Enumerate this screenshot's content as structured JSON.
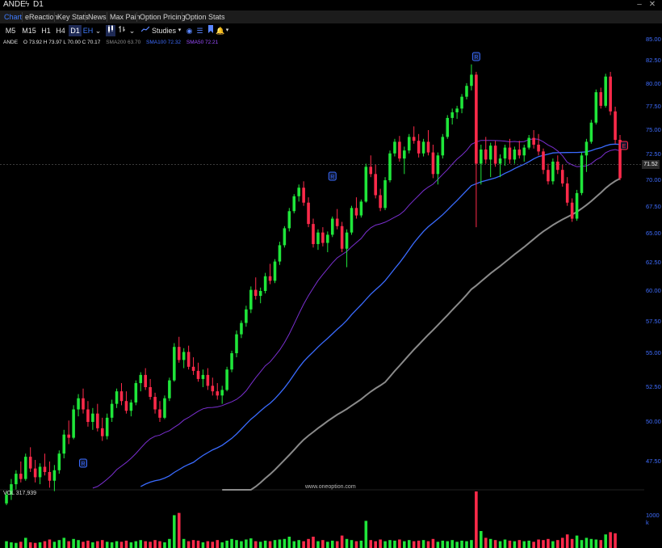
{
  "window": {
    "symbol": "ANDE",
    "flash_icon": "lightning-icon",
    "timeframe": "D1"
  },
  "tabs": [
    "Chart",
    "eReaction",
    "Key Stats",
    "News",
    "Max Pain",
    "Option Pricing",
    "Option Stats"
  ],
  "active_tab": "Chart",
  "toolbar": {
    "timeframes": [
      "M5",
      "M15",
      "H1",
      "H4",
      "D1"
    ],
    "active_timeframe": "D1",
    "eh_label": "EH",
    "studies_label": "Studies"
  },
  "indicators": {
    "symbol": "ANDE",
    "ohlc": "O 73.92  H 73.97  L 70.00  C 70.17",
    "sma200": "SMA200  63.70",
    "sma100": "SMA100  72.32",
    "sma50": "SMA50  72.21"
  },
  "colors": {
    "up": "#1fe63a",
    "down": "#ff2a4a",
    "sma100": "#3a6bff",
    "sma50": "#7a2fd0",
    "sma200": "#8a8a8a",
    "axis_text": "#3f6dff",
    "background": "#000000"
  },
  "price_axis": [
    "85.00",
    "82.50",
    "80.00",
    "77.50",
    "75.00",
    "72.50",
    "70.00",
    "67.50",
    "65.00",
    "62.50",
    "60.00",
    "57.50",
    "55.00",
    "52.50",
    "50.00",
    "47.50"
  ],
  "last_price": "71.52",
  "volume": {
    "label": "VOL  317,939",
    "axis_label": "1000 k"
  },
  "watermark": "www.oneoption.com",
  "event_markers": [
    "R",
    "R",
    "R",
    "E"
  ],
  "chart_data": {
    "type": "candlestick",
    "ylim": [
      45.0,
      86.0
    ],
    "grid": false,
    "candles": [
      [
        45.1,
        45.8,
        44.9,
        45.6
      ],
      [
        45.6,
        46.5,
        45.3,
        46.2
      ],
      [
        46.2,
        47.0,
        45.9,
        46.8
      ],
      [
        46.8,
        47.5,
        46.3,
        46.5
      ],
      [
        46.5,
        48.0,
        46.4,
        47.8
      ],
      [
        47.8,
        48.4,
        46.9,
        47.1
      ],
      [
        47.1,
        47.6,
        46.3,
        46.6
      ],
      [
        46.6,
        47.4,
        46.2,
        47.2
      ],
      [
        47.2,
        48.0,
        46.7,
        46.9
      ],
      [
        46.9,
        47.5,
        46.0,
        46.4
      ],
      [
        46.4,
        47.3,
        45.8,
        47.0
      ],
      [
        47.0,
        48.2,
        46.8,
        48.0
      ],
      [
        48.0,
        49.5,
        47.7,
        49.2
      ],
      [
        49.2,
        50.1,
        48.6,
        49.0
      ],
      [
        49.0,
        51.2,
        48.9,
        50.9
      ],
      [
        50.9,
        52.0,
        50.4,
        51.7
      ],
      [
        51.7,
        52.4,
        50.6,
        50.9
      ],
      [
        50.9,
        51.5,
        49.7,
        50.0
      ],
      [
        50.0,
        51.0,
        49.5,
        50.6
      ],
      [
        50.6,
        51.3,
        49.4,
        49.6
      ],
      [
        49.6,
        50.3,
        48.8,
        49.1
      ],
      [
        49.1,
        50.6,
        48.9,
        50.3
      ],
      [
        50.3,
        51.6,
        50.0,
        51.3
      ],
      [
        51.3,
        52.4,
        51.0,
        52.2
      ],
      [
        52.2,
        52.8,
        51.2,
        51.5
      ],
      [
        51.5,
        52.2,
        50.6,
        50.8
      ],
      [
        50.8,
        51.6,
        50.4,
        51.4
      ],
      [
        51.4,
        53.0,
        51.2,
        52.8
      ],
      [
        52.8,
        53.6,
        52.2,
        53.4
      ],
      [
        53.4,
        53.9,
        52.3,
        52.5
      ],
      [
        52.5,
        53.1,
        51.6,
        51.8
      ],
      [
        51.8,
        52.1,
        50.6,
        50.9
      ],
      [
        50.9,
        51.5,
        50.0,
        50.3
      ],
      [
        50.3,
        51.9,
        50.2,
        51.7
      ],
      [
        51.7,
        53.2,
        51.5,
        53.0
      ],
      [
        53.0,
        55.8,
        52.9,
        55.5
      ],
      [
        55.5,
        56.3,
        54.3,
        54.5
      ],
      [
        54.5,
        55.4,
        53.9,
        55.1
      ],
      [
        55.1,
        55.6,
        53.8,
        54.0
      ],
      [
        54.0,
        54.7,
        53.4,
        53.7
      ],
      [
        53.7,
        54.3,
        52.9,
        53.1
      ],
      [
        53.1,
        53.8,
        52.5,
        53.4
      ],
      [
        53.4,
        53.9,
        52.3,
        52.6
      ],
      [
        52.6,
        53.2,
        51.9,
        52.2
      ],
      [
        52.2,
        52.8,
        51.6,
        51.9
      ],
      [
        51.9,
        52.6,
        51.3,
        52.3
      ],
      [
        52.3,
        54.0,
        52.2,
        53.8
      ],
      [
        53.8,
        55.2,
        53.6,
        55.0
      ],
      [
        55.0,
        56.8,
        54.7,
        56.5
      ],
      [
        56.5,
        57.6,
        56.2,
        57.4
      ],
      [
        57.4,
        58.8,
        57.1,
        58.5
      ],
      [
        58.5,
        60.4,
        58.2,
        60.1
      ],
      [
        60.1,
        61.2,
        59.3,
        59.6
      ],
      [
        59.6,
        60.3,
        59.0,
        60.0
      ],
      [
        60.0,
        61.6,
        59.8,
        61.3
      ],
      [
        61.3,
        62.4,
        60.6,
        60.9
      ],
      [
        60.9,
        62.8,
        60.7,
        62.6
      ],
      [
        62.6,
        64.3,
        62.3,
        64.0
      ],
      [
        64.0,
        65.7,
        63.8,
        65.5
      ],
      [
        65.5,
        67.4,
        65.2,
        67.1
      ],
      [
        67.1,
        68.7,
        66.9,
        68.5
      ],
      [
        68.5,
        69.6,
        68.0,
        69.3
      ],
      [
        69.3,
        69.9,
        67.6,
        67.9
      ],
      [
        67.9,
        68.4,
        65.6,
        65.9
      ],
      [
        65.9,
        66.4,
        63.8,
        64.1
      ],
      [
        64.1,
        65.4,
        63.6,
        65.1
      ],
      [
        65.1,
        65.6,
        63.9,
        64.2
      ],
      [
        64.2,
        65.2,
        63.4,
        64.9
      ],
      [
        64.9,
        66.6,
        64.7,
        66.4
      ],
      [
        66.4,
        67.3,
        65.4,
        65.7
      ],
      [
        65.7,
        66.1,
        63.4,
        63.7
      ],
      [
        63.7,
        65.4,
        62.1,
        65.1
      ],
      [
        65.1,
        67.6,
        64.9,
        67.4
      ],
      [
        67.4,
        68.4,
        66.4,
        66.7
      ],
      [
        66.7,
        68.2,
        66.5,
        68.0
      ],
      [
        68.0,
        71.6,
        67.9,
        71.3
      ],
      [
        71.3,
        72.4,
        70.3,
        70.6
      ],
      [
        70.6,
        71.5,
        68.3,
        68.6
      ],
      [
        68.6,
        69.2,
        67.1,
        67.4
      ],
      [
        67.4,
        70.3,
        67.2,
        70.0
      ],
      [
        70.0,
        72.9,
        69.8,
        72.6
      ],
      [
        72.6,
        74.1,
        72.3,
        73.8
      ],
      [
        73.8,
        74.4,
        71.8,
        72.1
      ],
      [
        72.1,
        73.3,
        70.6,
        72.9
      ],
      [
        72.9,
        74.6,
        72.6,
        74.3
      ],
      [
        74.3,
        75.4,
        73.6,
        73.9
      ],
      [
        73.9,
        74.6,
        72.2,
        72.6
      ],
      [
        72.6,
        74.1,
        72.3,
        73.8
      ],
      [
        73.8,
        75.0,
        72.4,
        72.7
      ],
      [
        72.7,
        73.5,
        70.2,
        70.6
      ],
      [
        70.6,
        72.7,
        69.6,
        72.4
      ],
      [
        72.4,
        74.6,
        72.1,
        74.3
      ],
      [
        74.3,
        76.6,
        74.1,
        76.3
      ],
      [
        76.3,
        77.3,
        75.6,
        76.9
      ],
      [
        76.9,
        77.6,
        76.2,
        77.3
      ],
      [
        77.3,
        78.9,
        76.8,
        78.6
      ],
      [
        78.6,
        80.1,
        78.3,
        79.8
      ],
      [
        79.8,
        82.1,
        79.3,
        81.0
      ],
      [
        81.0,
        81.3,
        65.6,
        71.6
      ],
      [
        71.6,
        73.5,
        69.6,
        73.0
      ],
      [
        73.0,
        74.3,
        71.6,
        72.0
      ],
      [
        72.0,
        73.7,
        70.3,
        73.4
      ],
      [
        73.4,
        73.9,
        71.3,
        71.6
      ],
      [
        71.6,
        72.5,
        70.3,
        72.1
      ],
      [
        72.1,
        73.5,
        71.4,
        73.2
      ],
      [
        73.2,
        74.1,
        71.6,
        72.0
      ],
      [
        72.0,
        73.3,
        71.6,
        73.0
      ],
      [
        73.0,
        73.9,
        72.1,
        72.4
      ],
      [
        72.4,
        73.5,
        71.8,
        73.2
      ],
      [
        73.2,
        74.5,
        73.0,
        74.2
      ],
      [
        74.2,
        75.0,
        73.1,
        73.5
      ],
      [
        73.5,
        74.6,
        72.4,
        72.8
      ],
      [
        72.8,
        73.1,
        70.6,
        71.0
      ],
      [
        71.0,
        71.6,
        69.6,
        69.9
      ],
      [
        69.9,
        72.1,
        69.6,
        71.8
      ],
      [
        71.8,
        72.4,
        70.6,
        71.0
      ],
      [
        71.0,
        71.5,
        69.4,
        69.7
      ],
      [
        69.7,
        70.3,
        67.6,
        67.9
      ],
      [
        67.9,
        68.3,
        66.1,
        66.4
      ],
      [
        66.4,
        69.1,
        66.2,
        68.8
      ],
      [
        68.8,
        72.7,
        68.6,
        72.4
      ],
      [
        72.4,
        74.1,
        70.8,
        73.8
      ],
      [
        73.8,
        76.1,
        73.6,
        75.8
      ],
      [
        75.8,
        79.4,
        75.6,
        79.1
      ],
      [
        79.1,
        79.6,
        77.3,
        77.6
      ],
      [
        77.6,
        81.1,
        77.4,
        80.8
      ],
      [
        80.8,
        81.3,
        76.6,
        77.0
      ],
      [
        77.0,
        77.5,
        73.6,
        74.0
      ],
      [
        74.0,
        74.5,
        70.0,
        70.2
      ]
    ],
    "volume_ratio": [
      0.12,
      0.1,
      0.09,
      0.11,
      0.18,
      0.1,
      0.09,
      0.1,
      0.12,
      0.15,
      0.11,
      0.14,
      0.18,
      0.12,
      0.16,
      0.14,
      0.11,
      0.13,
      0.1,
      0.12,
      0.14,
      0.11,
      0.1,
      0.12,
      0.11,
      0.13,
      0.1,
      0.12,
      0.14,
      0.12,
      0.11,
      0.14,
      0.12,
      0.1,
      0.16,
      0.58,
      0.62,
      0.16,
      0.12,
      0.14,
      0.13,
      0.1,
      0.12,
      0.11,
      0.14,
      0.1,
      0.13,
      0.16,
      0.14,
      0.12,
      0.15,
      0.17,
      0.12,
      0.11,
      0.13,
      0.12,
      0.14,
      0.15,
      0.16,
      0.2,
      0.12,
      0.14,
      0.12,
      0.16,
      0.2,
      0.12,
      0.14,
      0.11,
      0.13,
      0.12,
      0.22,
      0.16,
      0.14,
      0.12,
      0.13,
      0.48,
      0.14,
      0.12,
      0.15,
      0.12,
      0.14,
      0.13,
      0.15,
      0.12,
      0.14,
      0.12,
      0.13,
      0.14,
      0.12,
      0.16,
      0.11,
      0.13,
      0.12,
      0.14,
      0.11,
      0.13,
      0.12,
      0.14,
      1.0,
      0.3,
      0.18,
      0.16,
      0.14,
      0.12,
      0.15,
      0.13,
      0.12,
      0.14,
      0.12,
      0.13,
      0.11,
      0.15,
      0.14,
      0.16,
      0.12,
      0.14,
      0.18,
      0.24,
      0.16,
      0.22,
      0.14,
      0.18,
      0.16,
      0.15,
      0.14,
      0.24,
      0.28,
      0.26
    ]
  }
}
